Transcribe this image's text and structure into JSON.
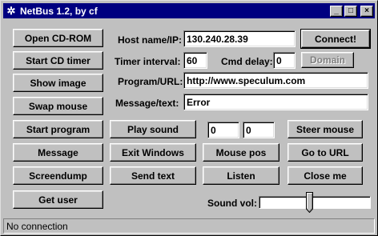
{
  "window": {
    "title": "NetBus 1.2, by cf",
    "icon": "gear-icon",
    "controls": {
      "minimize": "_",
      "maximize": "□",
      "close": "×"
    }
  },
  "left_buttons": [
    "Open CD-ROM",
    "Start CD timer",
    "Show image",
    "Swap mouse",
    "Start program",
    "Message",
    "Screendump",
    "Get user"
  ],
  "connection": {
    "host_label": "Host name/IP:",
    "host_value": "130.240.28.39",
    "connect_label": "Connect!",
    "interval_label": "Timer interval:",
    "interval_value": "60",
    "cmd_delay_label": "Cmd delay:",
    "cmd_delay_value": "0",
    "domain_label": "Domain",
    "program_label": "Program/URL:",
    "program_value": "http://www.speculum.com",
    "message_label": "Message/text:",
    "message_value": "Error"
  },
  "actions": {
    "play_sound": "Play sound",
    "coord_x": "0",
    "coord_y": "0",
    "steer_mouse": "Steer mouse",
    "exit_windows": "Exit Windows",
    "mouse_pos": "Mouse pos",
    "go_to_url": "Go to URL",
    "send_text": "Send text",
    "listen": "Listen",
    "close_me": "Close me"
  },
  "sound": {
    "label": "Sound vol:",
    "level": 0.45
  },
  "status": {
    "text": "No connection"
  }
}
